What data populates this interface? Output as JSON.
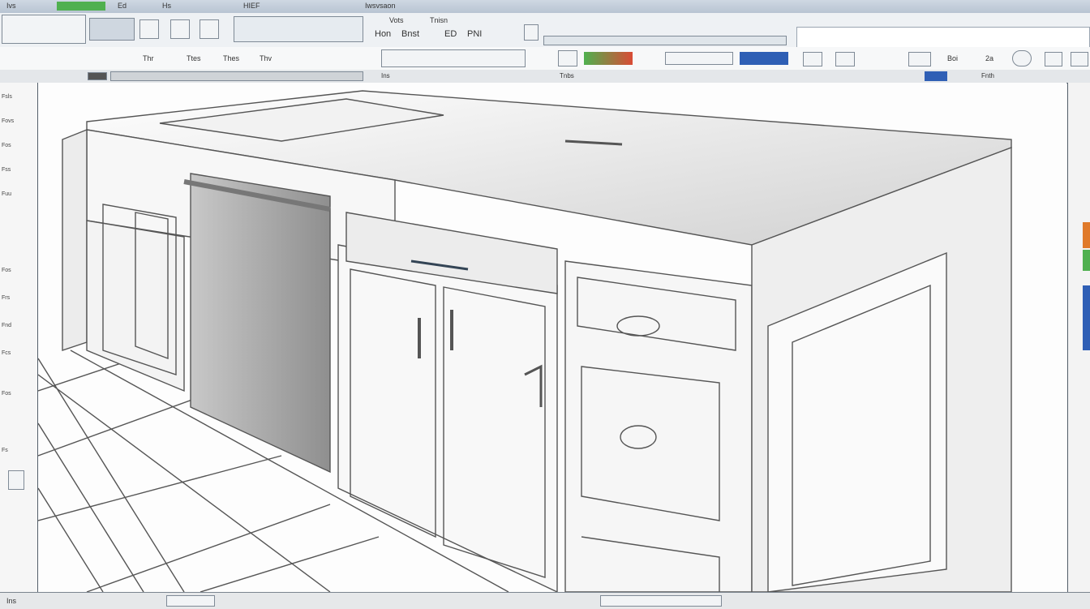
{
  "title_bar": {
    "menu_a": "Ivs",
    "menu_b": "Ed",
    "menu_c": "Hs",
    "menu_d": "HIEF",
    "menu_e": "Iwsvsaon"
  },
  "ribbon": {
    "group_label_1": "Vots",
    "group_label_2": "Tnisn",
    "group_label_3": "Hon",
    "group_label_4": "Bnst",
    "group_label_5": "ED",
    "group_label_6": "PNI",
    "row2_label_a": "Thr",
    "row2_label_b": "Ttes",
    "row2_label_c": "Thes",
    "row2_label_d": "Thv",
    "row2_label_e": "Boi",
    "row2_label_f": "2a",
    "row3_label_a": "Ins",
    "row3_label_b": "Tnbs",
    "row3_label_c": "Fnth"
  },
  "left_panel": {
    "items": [
      "Fsls",
      "Fovs",
      "Fos",
      "Fss",
      "Fuu",
      "Fos",
      "Frs",
      "Fnd",
      "Fcs",
      "Fos",
      "Fs"
    ]
  },
  "status_bar": {
    "label": "Ins"
  },
  "colors": {
    "accent_green": "#4fb04f",
    "accent_red": "#d94b35",
    "accent_blue": "#2f5fb5",
    "accent_orange": "#e07a2a",
    "ribbon_bg": "#eef1f4",
    "canvas_bg": "#fdfdfd"
  }
}
